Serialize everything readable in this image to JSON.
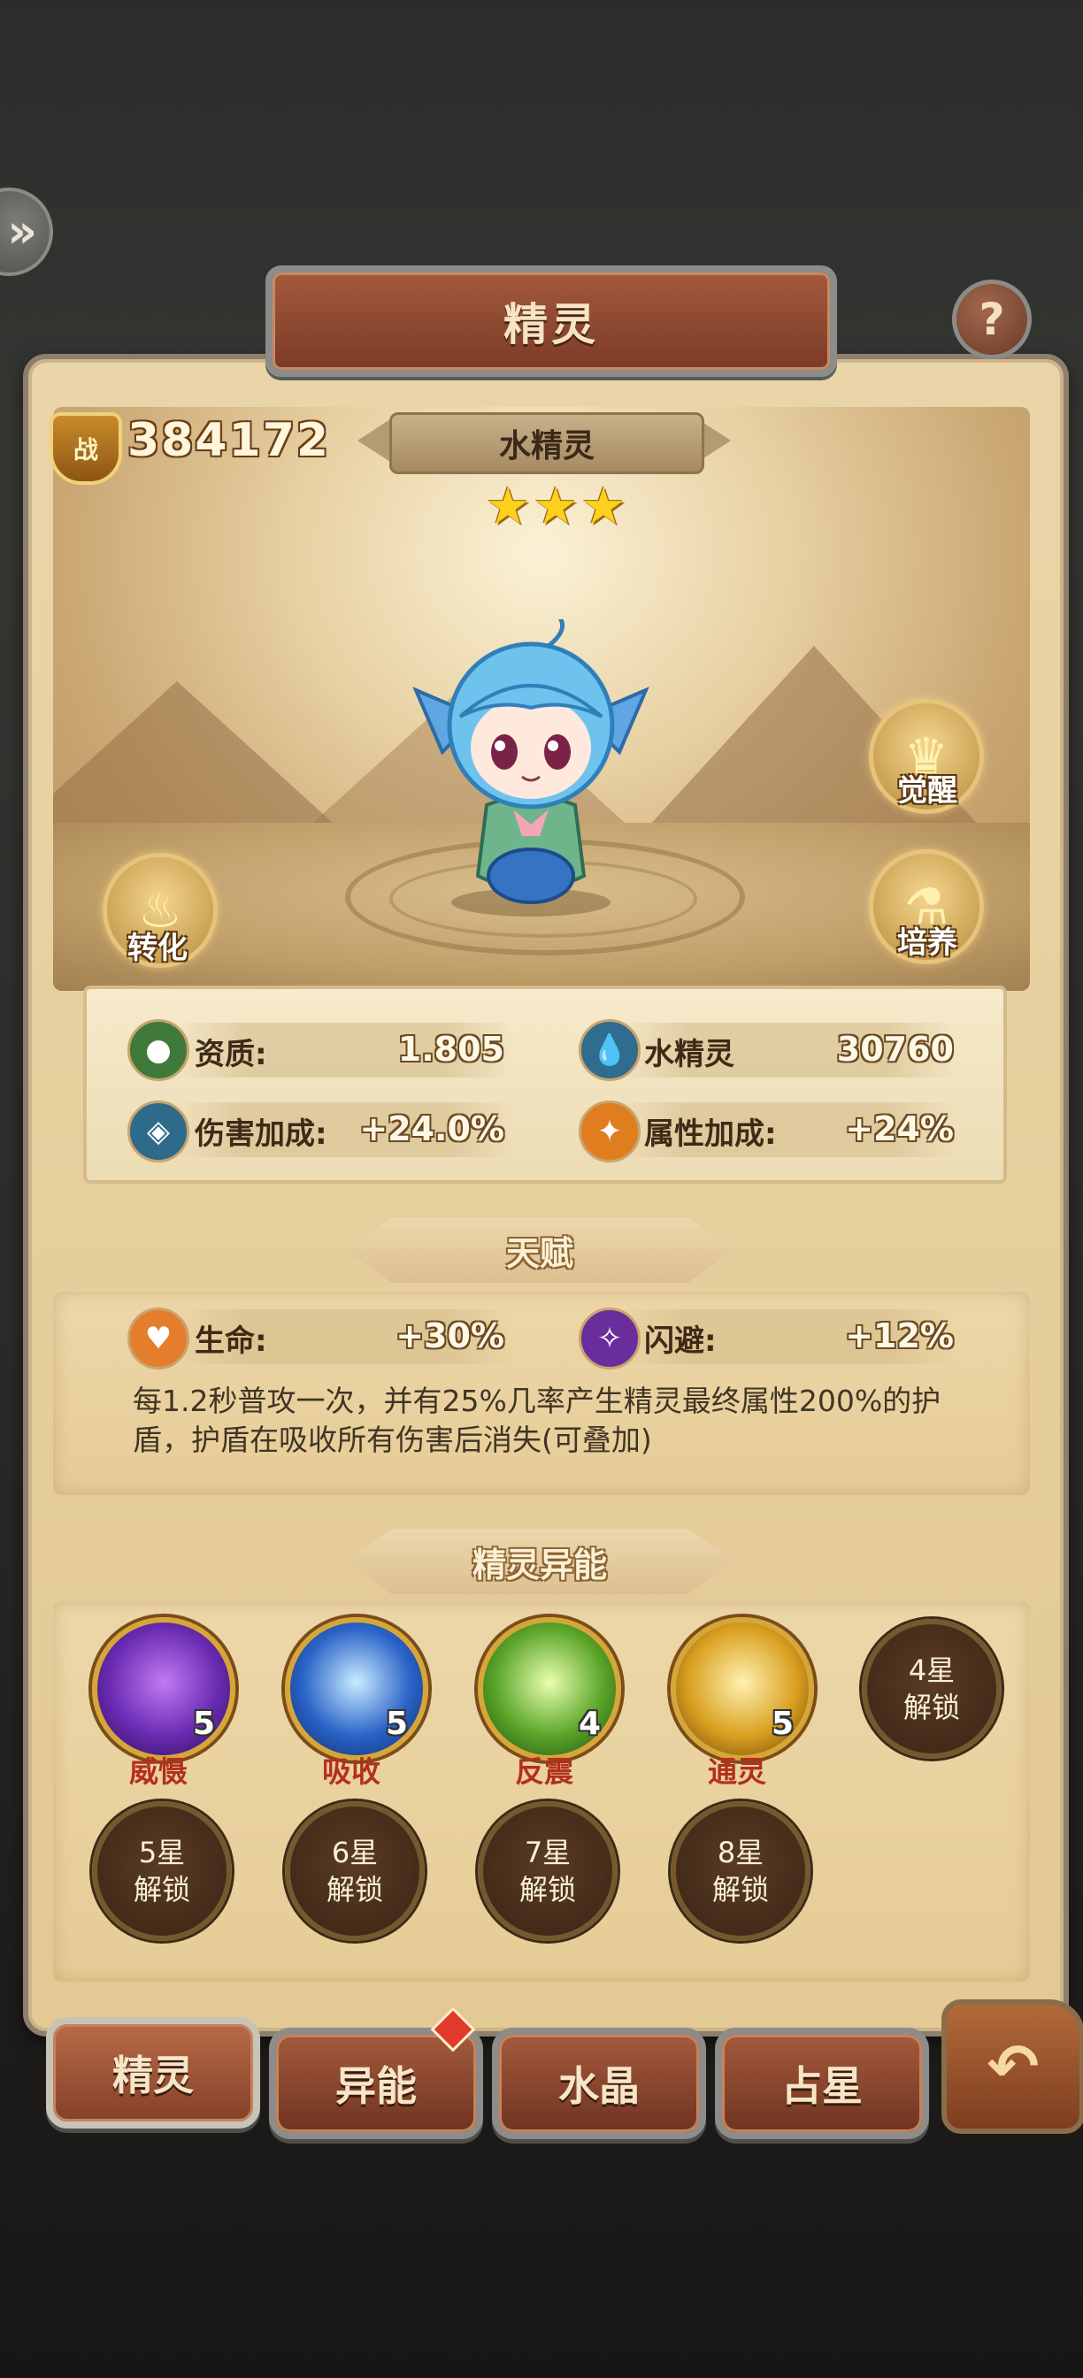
{
  "title": "精灵",
  "help_label": "?",
  "power": {
    "badge": "战",
    "value": "384172"
  },
  "spirit": {
    "name": "水精灵",
    "stars": 3
  },
  "side_buttons": {
    "awaken": "觉醒",
    "convert": "转化",
    "cultivate": "培养"
  },
  "stats": [
    {
      "label": "资质:",
      "value": "1.805",
      "icon": "aptitude-icon",
      "color": "#3f7a3a"
    },
    {
      "label": "水精灵",
      "value": "30760",
      "icon": "water-drop-icon",
      "color": "#2f6c8f"
    },
    {
      "label": "伤害加成:",
      "value": "+24.0%",
      "icon": "damage-bonus-icon",
      "color": "#2e6a8a"
    },
    {
      "label": "属性加成:",
      "value": "+24%",
      "icon": "attribute-bonus-icon",
      "color": "#e07d1f"
    }
  ],
  "talent": {
    "header": "天赋",
    "stats": [
      {
        "label": "生命:",
        "value": "+30%",
        "icon": "heart-icon",
        "color": "#e47d2c"
      },
      {
        "label": "闪避:",
        "value": "+12%",
        "icon": "dodge-icon",
        "color": "#6a2d9c"
      }
    ],
    "description": "每1.2秒普攻一次，并有25%几率产生精灵最终属性200%的护盾，护盾在吸收所有伤害后消失(可叠加)"
  },
  "abilities": {
    "header": "精灵异能",
    "unlocked": [
      {
        "name": "威慑",
        "level": "5",
        "icon": "intimidate-icon",
        "color": "#6a2bb3"
      },
      {
        "name": "吸收",
        "level": "5",
        "icon": "absorb-icon",
        "color": "#2a63c8"
      },
      {
        "name": "反震",
        "level": "4",
        "icon": "counter-shock-icon",
        "color": "#5aa528"
      },
      {
        "name": "通灵",
        "level": "5",
        "icon": "spirit-link-icon",
        "color": "#d9a020"
      }
    ],
    "locked": [
      {
        "star": "4星",
        "text": "解锁"
      },
      {
        "star": "5星",
        "text": "解锁"
      },
      {
        "star": "6星",
        "text": "解锁"
      },
      {
        "star": "7星",
        "text": "解锁"
      },
      {
        "star": "8星",
        "text": "解锁"
      }
    ]
  },
  "tabs": [
    {
      "label": "精灵",
      "active": true
    },
    {
      "label": "异能",
      "badge": true
    },
    {
      "label": "水晶"
    },
    {
      "label": "占星"
    }
  ],
  "back_icon": "back-arrow-icon"
}
